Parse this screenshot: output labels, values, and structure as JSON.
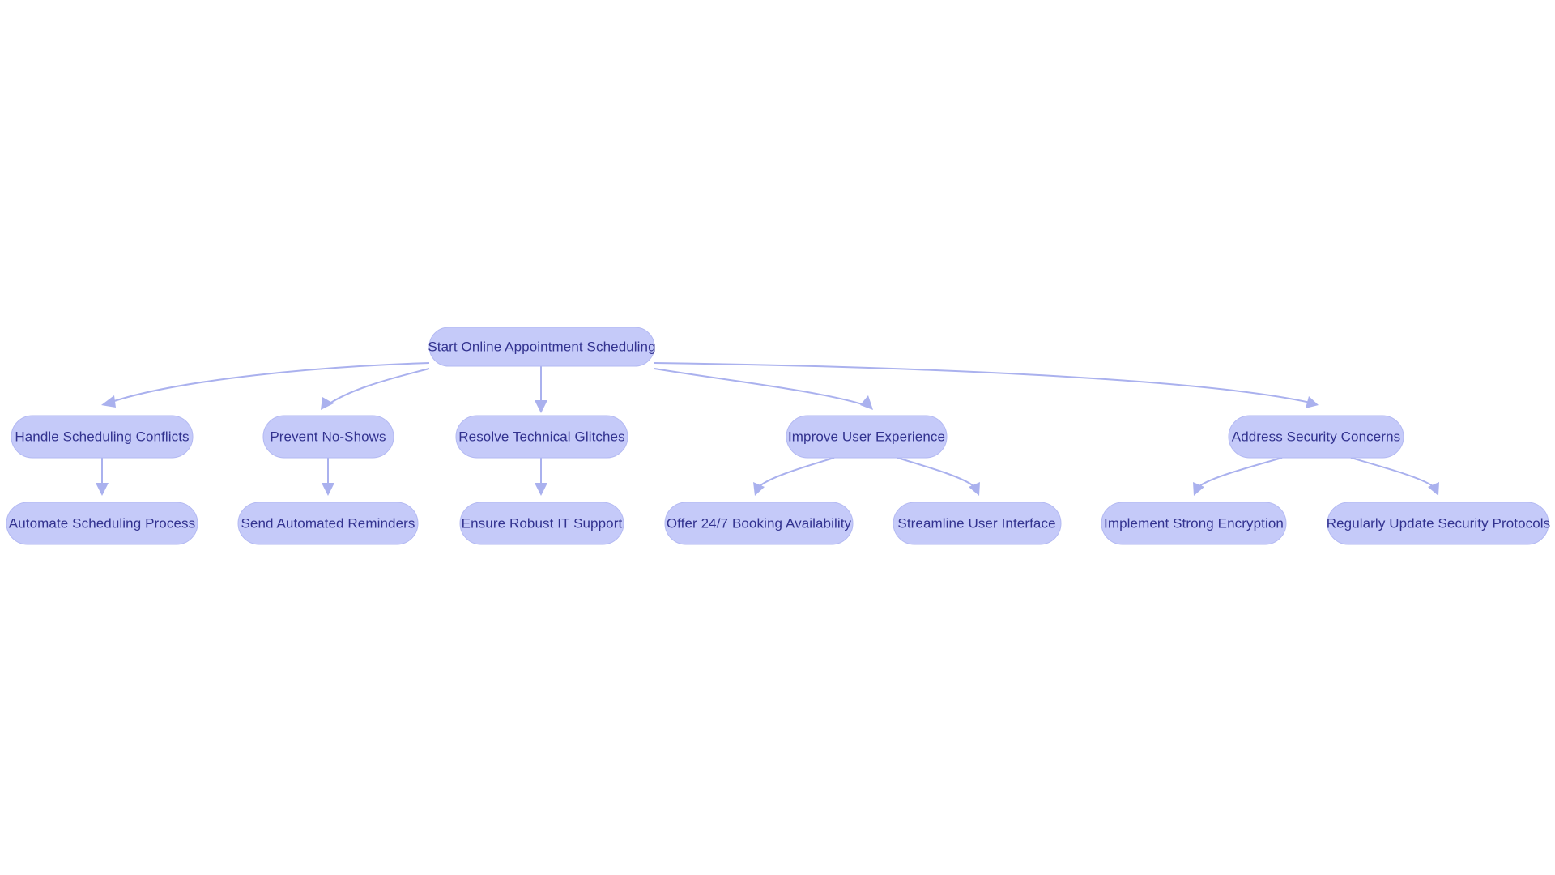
{
  "diagram": {
    "type": "flowchart",
    "orientation": "top-down",
    "background_color": "#ffffff",
    "node_fill_color": "#c5caf9",
    "node_border_color": "#b3b9f2",
    "node_text_color": "#32328f",
    "edge_color": "#aab1ee",
    "root": {
      "id": "start",
      "label": "Start Online Appointment Scheduling"
    },
    "branches": [
      {
        "id": "handle-scheduling-conflicts",
        "label": "Handle Scheduling Conflicts",
        "children": [
          {
            "id": "automate-scheduling-process",
            "label": "Automate Scheduling Process"
          }
        ]
      },
      {
        "id": "prevent-no-shows",
        "label": "Prevent No-Shows",
        "children": [
          {
            "id": "send-automated-reminders",
            "label": "Send Automated Reminders"
          }
        ]
      },
      {
        "id": "resolve-technical-glitches",
        "label": "Resolve Technical Glitches",
        "children": [
          {
            "id": "ensure-robust-it-support",
            "label": "Ensure Robust IT Support"
          }
        ]
      },
      {
        "id": "improve-user-experience",
        "label": "Improve User Experience",
        "children": [
          {
            "id": "offer-247-booking-availability",
            "label": "Offer 24/7 Booking Availability"
          },
          {
            "id": "streamline-user-interface",
            "label": "Streamline User Interface"
          }
        ]
      },
      {
        "id": "address-security-concerns",
        "label": "Address Security Concerns",
        "children": [
          {
            "id": "implement-strong-encryption",
            "label": "Implement Strong Encryption"
          },
          {
            "id": "regularly-update-security-protocols",
            "label": "Regularly Update Security Protocols"
          }
        ]
      }
    ]
  }
}
